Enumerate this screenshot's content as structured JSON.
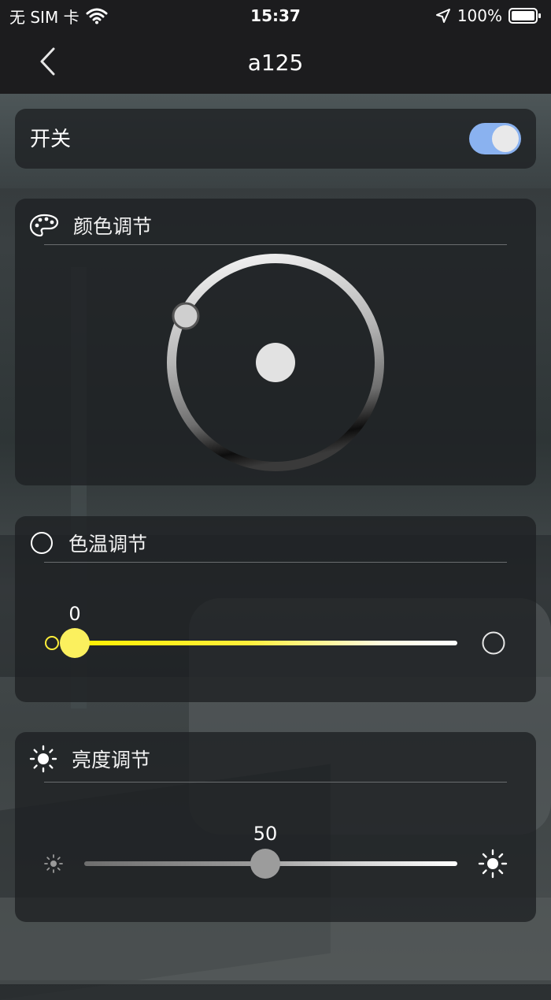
{
  "status_bar": {
    "carrier": "无 SIM 卡",
    "time": "15:37",
    "battery": "100%",
    "icons": [
      "wifi-icon",
      "location-arrow-icon",
      "battery-icon"
    ]
  },
  "nav": {
    "title": "a125",
    "back_icon": "chevron-left-icon"
  },
  "power": {
    "label": "开关",
    "on": true,
    "accent": "#8ab2f0"
  },
  "color_section": {
    "title": "颜色调节",
    "icon": "palette-icon"
  },
  "temp_section": {
    "title": "色温调节",
    "icon": "circle-outline-icon",
    "value": "0",
    "accent": "#ffef3a"
  },
  "brightness_section": {
    "title": "亮度调节",
    "icon": "sun-icon",
    "value": "50",
    "level": 0.5
  }
}
